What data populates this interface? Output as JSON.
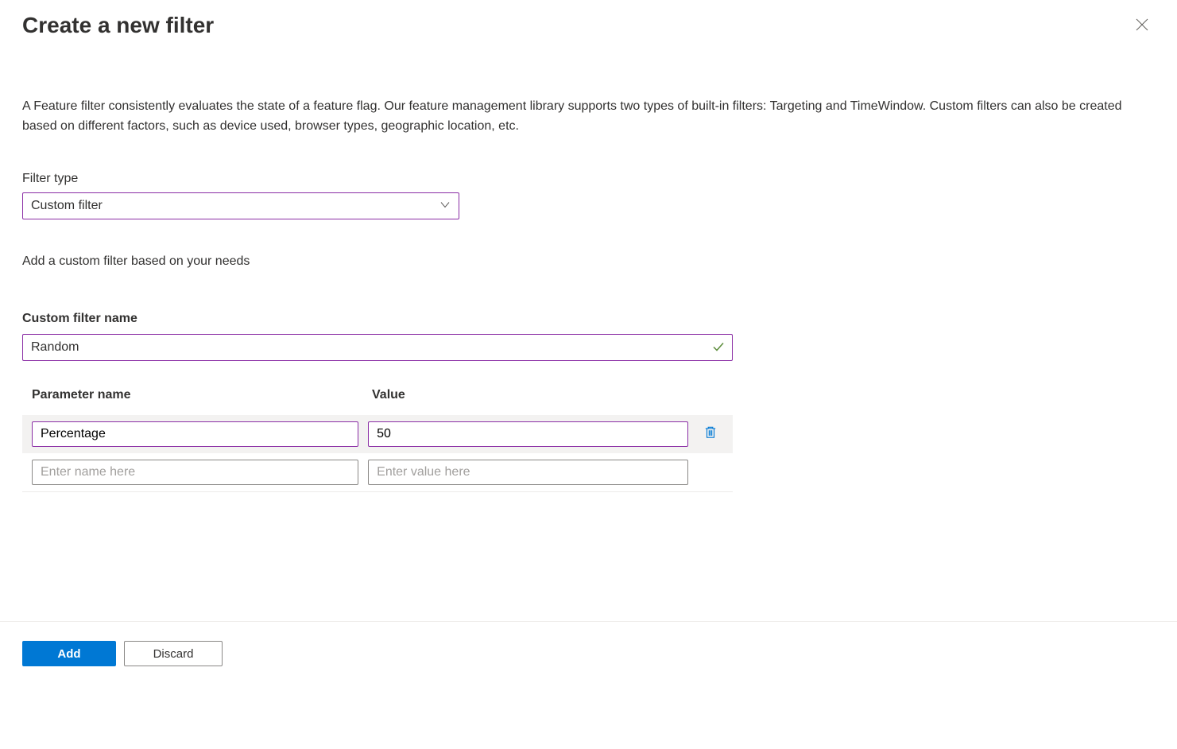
{
  "header": {
    "title": "Create a new filter"
  },
  "description": "A Feature filter consistently evaluates the state of a feature flag. Our feature management library supports two types of built-in filters: Targeting and TimeWindow. Custom filters can also be created based on different factors, such as device used, browser types, geographic location, etc.",
  "filterType": {
    "label": "Filter type",
    "selected": "Custom filter",
    "helper": "Add a custom filter based on your needs"
  },
  "customFilterName": {
    "label": "Custom filter name",
    "value": "Random"
  },
  "paramsTable": {
    "header": {
      "name": "Parameter name",
      "value": "Value"
    },
    "rows": [
      {
        "name": "Percentage",
        "value": "50"
      }
    ],
    "blankRow": {
      "namePlaceholder": "Enter name here",
      "valuePlaceholder": "Enter value here"
    }
  },
  "footer": {
    "add": "Add",
    "discard": "Discard"
  }
}
